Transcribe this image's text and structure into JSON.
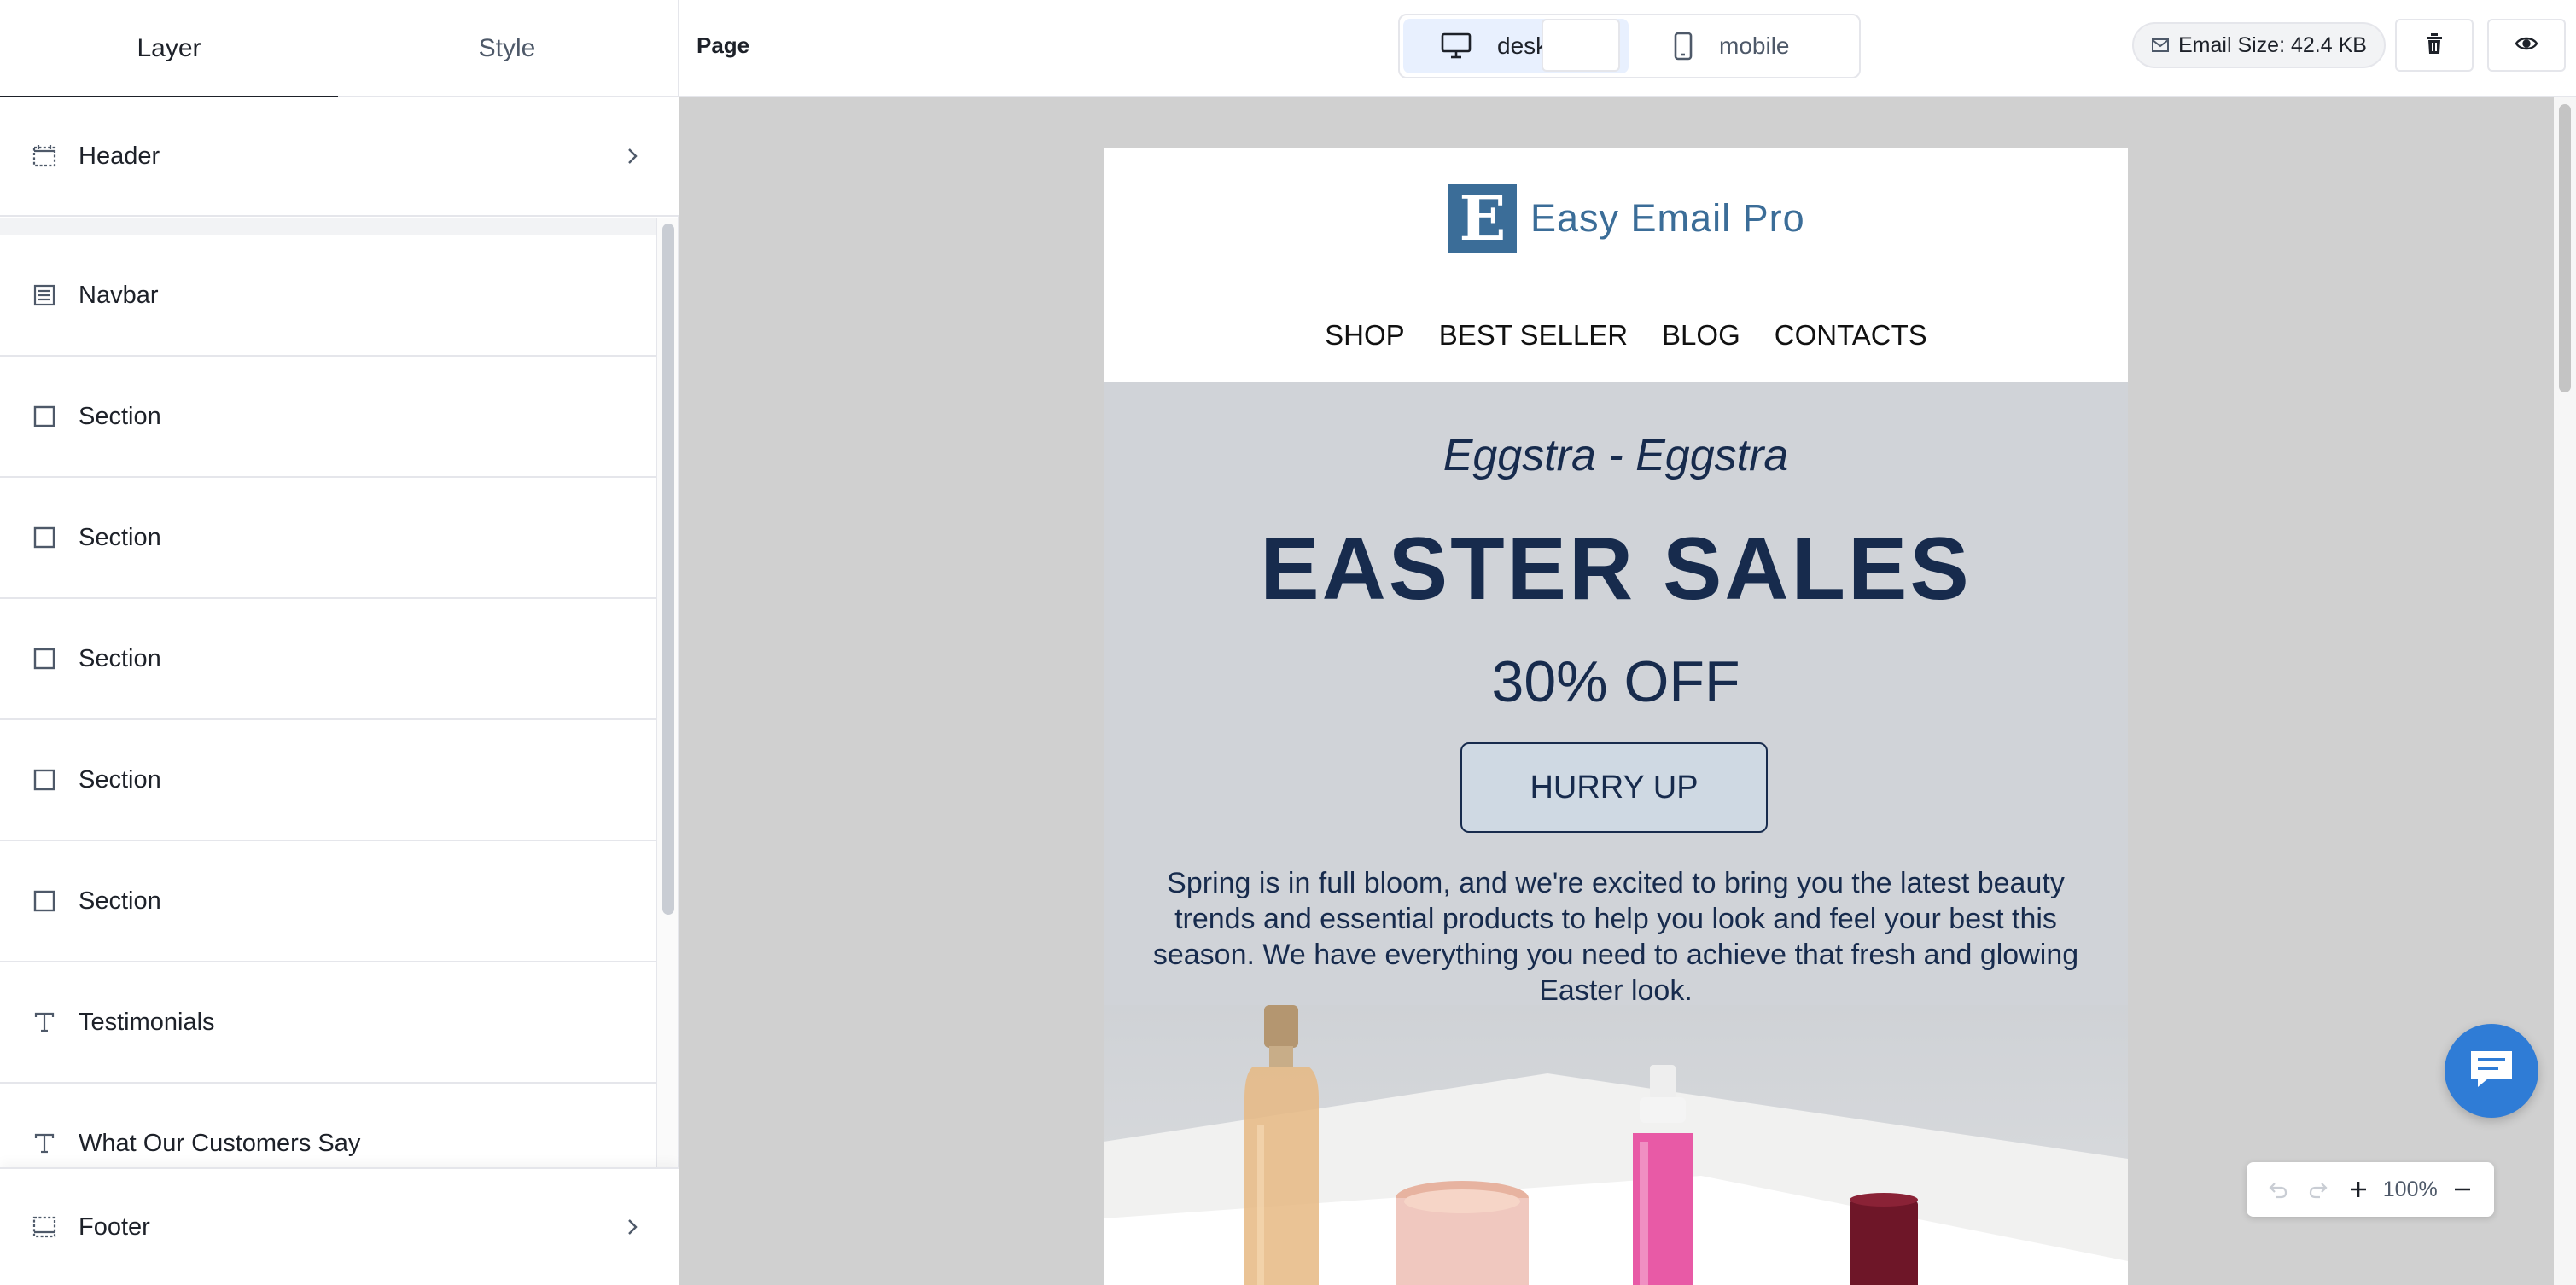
{
  "left_panel": {
    "tabs": [
      {
        "label": "Layer",
        "active": true
      },
      {
        "label": "Style",
        "active": false
      }
    ],
    "header_item": {
      "label": "Header",
      "icon": "header-block-icon"
    },
    "layers": [
      {
        "label": "Navbar",
        "icon": "navbar-icon"
      },
      {
        "label": "Section",
        "icon": "section-icon"
      },
      {
        "label": "Section",
        "icon": "section-icon"
      },
      {
        "label": "Section",
        "icon": "section-icon"
      },
      {
        "label": "Section",
        "icon": "section-icon"
      },
      {
        "label": "Section",
        "icon": "section-icon"
      },
      {
        "label": "Testimonials",
        "icon": "text-icon"
      },
      {
        "label": "What Our Customers Say",
        "icon": "text-icon"
      }
    ],
    "footer_item": {
      "label": "Footer",
      "icon": "footer-block-icon"
    }
  },
  "topbar": {
    "page_label": "Page",
    "devices": [
      {
        "label": "desktop",
        "icon": "desktop-icon",
        "active": true
      },
      {
        "label": "mobile",
        "icon": "mobile-icon",
        "active": false
      }
    ],
    "email_size": "Email Size: 42.4 KB"
  },
  "email": {
    "logo_letter": "E",
    "logo_text": "Easy Email Pro",
    "nav": [
      "SHOP",
      "BEST SELLER",
      "BLOG",
      "CONTACTS"
    ],
    "tagline": "Eggstra - Eggstra",
    "headline": "EASTER SALES",
    "offer": "30% OFF",
    "cta": "HURRY UP",
    "body": "Spring is in full bloom, and we're excited to bring you the latest beauty trends and essential products to help you look and feel your best this season. We have everything you need to achieve that fresh and glowing Easter look."
  },
  "zoom": {
    "level": "100%"
  },
  "colors": {
    "brand_blue": "#3b6d98",
    "navy": "#172b4d",
    "accent_blue": "#2f7cd6",
    "active_device_bg": "#e8f0fe"
  }
}
